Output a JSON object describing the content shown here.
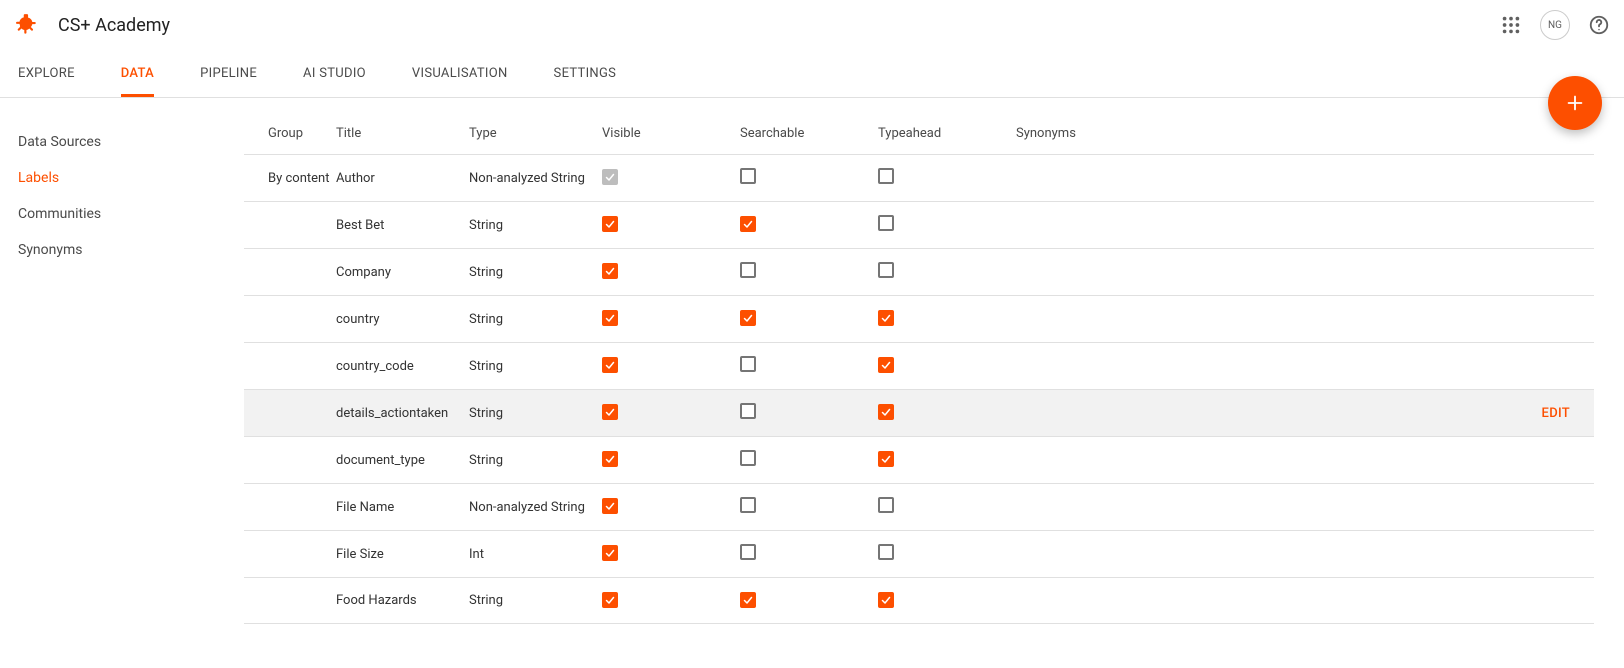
{
  "header": {
    "title": "CS+ Academy",
    "avatar_initials": "NG"
  },
  "tabs": [
    {
      "label": "EXPLORE",
      "active": false
    },
    {
      "label": "DATA",
      "active": true
    },
    {
      "label": "PIPELINE",
      "active": false
    },
    {
      "label": "AI STUDIO",
      "active": false
    },
    {
      "label": "VISUALISATION",
      "active": false
    },
    {
      "label": "SETTINGS",
      "active": false
    }
  ],
  "sidenav": [
    {
      "label": "Data Sources",
      "active": false
    },
    {
      "label": "Labels",
      "active": true
    },
    {
      "label": "Communities",
      "active": false
    },
    {
      "label": "Synonyms",
      "active": false
    }
  ],
  "columns": {
    "group": "Group",
    "title": "Title",
    "type": "Type",
    "visible": "Visible",
    "searchable": "Searchable",
    "typeahead": "Typeahead",
    "synonyms": "Synonyms"
  },
  "actions": {
    "edit": "EDIT"
  },
  "rows": [
    {
      "group": "By content",
      "title": "Author",
      "type": "Non-analyzed String",
      "visible": "disabled",
      "searchable": false,
      "typeahead": false,
      "highlight": false
    },
    {
      "group": "",
      "title": "Best Bet",
      "type": "String",
      "visible": true,
      "searchable": true,
      "typeahead": false,
      "highlight": false
    },
    {
      "group": "",
      "title": "Company",
      "type": "String",
      "visible": true,
      "searchable": false,
      "typeahead": false,
      "highlight": false
    },
    {
      "group": "",
      "title": "country",
      "type": "String",
      "visible": true,
      "searchable": true,
      "typeahead": true,
      "highlight": false
    },
    {
      "group": "",
      "title": "country_code",
      "type": "String",
      "visible": true,
      "searchable": false,
      "typeahead": true,
      "highlight": false
    },
    {
      "group": "",
      "title": "details_actiontaken",
      "type": "String",
      "visible": true,
      "searchable": false,
      "typeahead": true,
      "highlight": true
    },
    {
      "group": "",
      "title": "document_type",
      "type": "String",
      "visible": true,
      "searchable": false,
      "typeahead": true,
      "highlight": false
    },
    {
      "group": "",
      "title": "File Name",
      "type": "Non-analyzed String",
      "visible": true,
      "searchable": false,
      "typeahead": false,
      "highlight": false
    },
    {
      "group": "",
      "title": "File Size",
      "type": "Int",
      "visible": true,
      "searchable": false,
      "typeahead": false,
      "highlight": false
    },
    {
      "group": "",
      "title": "Food Hazards",
      "type": "String",
      "visible": true,
      "searchable": true,
      "typeahead": true,
      "highlight": false
    }
  ]
}
